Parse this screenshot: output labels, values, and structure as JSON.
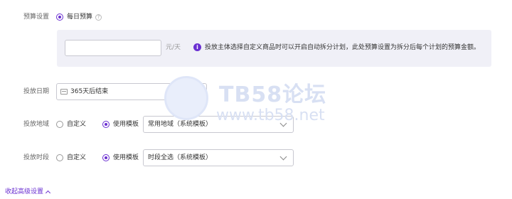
{
  "budget": {
    "label": "预算设置",
    "option_label": "每日预算",
    "unit": "元/天",
    "info_icon": "i",
    "info_text": "投放主体选择自定义商品时可以开启自动拆分计划，此处预算设置为拆分后每个计划的预算金额。"
  },
  "schedule_date": {
    "label": "投放日期",
    "value": "365天后结束"
  },
  "region": {
    "label": "投放地域",
    "custom_label": "自定义",
    "template_label": "使用模板",
    "selected_template": "常用地域（系统模板）"
  },
  "time_slot": {
    "label": "投放时段",
    "custom_label": "自定义",
    "template_label": "使用模板",
    "selected_template": "时段全选（系统模板）"
  },
  "advanced": {
    "collapse_label": "收起高级设置"
  },
  "watermark": {
    "title": "TB58论坛",
    "url": "www.tb58.net"
  },
  "colors": {
    "accent": "#6a2fd1",
    "panel_bg": "#f0f0f7",
    "border": "#c8c8d0"
  }
}
